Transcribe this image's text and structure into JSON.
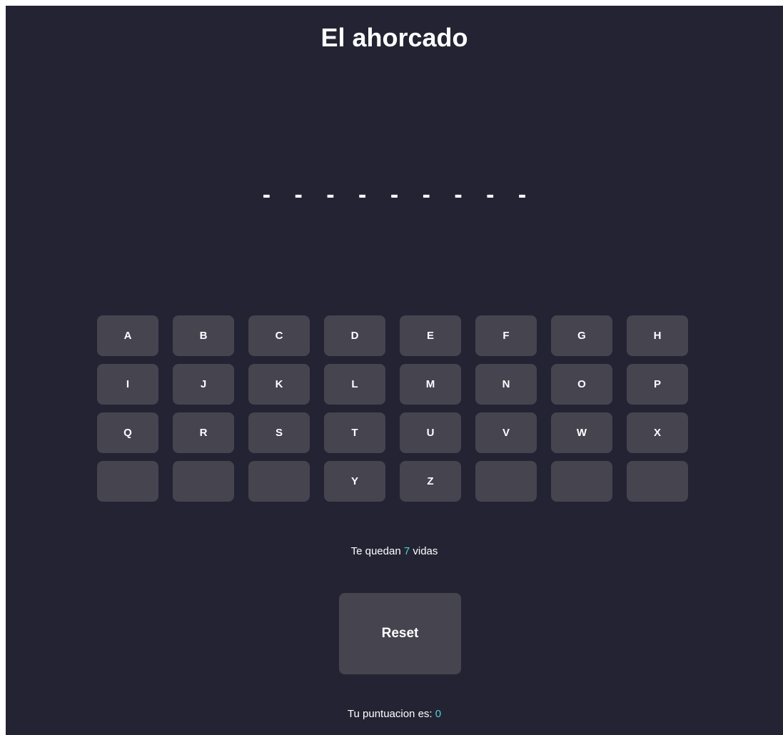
{
  "game": {
    "title": "El ahorcado",
    "word_mask": "- - - - - - - - -"
  },
  "keyboard": {
    "keys": [
      "A",
      "B",
      "C",
      "D",
      "E",
      "F",
      "G",
      "H",
      "I",
      "J",
      "K",
      "L",
      "M",
      "N",
      "O",
      "P",
      "Q",
      "R",
      "S",
      "T",
      "U",
      "V",
      "W",
      "X",
      "",
      "",
      "",
      "Y",
      "Z",
      "",
      "",
      ""
    ]
  },
  "status": {
    "lives_prefix": "Te quedan",
    "lives_count": "7",
    "lives_suffix": "vidas",
    "score_prefix": "Tu puntuacion es:",
    "score_value": "0"
  },
  "controls": {
    "reset_label": "Reset"
  },
  "colors": {
    "background": "#242333",
    "key_background": "#45444f",
    "accent": "#4fd0d8"
  }
}
